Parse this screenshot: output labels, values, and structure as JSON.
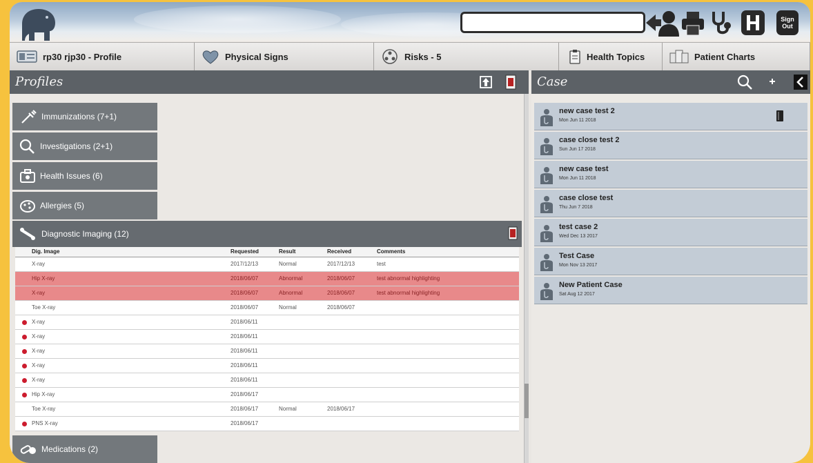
{
  "header": {
    "search_placeholder": "",
    "signout_line1": "Sign",
    "signout_line2": "Out"
  },
  "tabs": [
    {
      "label": "rp30 rjp30 - Profile"
    },
    {
      "label": "Physical Signs"
    },
    {
      "label": "Risks - 5"
    },
    {
      "label": "Health Topics"
    },
    {
      "label": "Patient Charts"
    }
  ],
  "profiles": {
    "title": "Profiles",
    "categories": [
      {
        "label": "Immunizations  (7+1)"
      },
      {
        "label": "Investigations  (2+1)"
      },
      {
        "label": "Health Issues  (6)"
      },
      {
        "label": "Allergies  (5)"
      }
    ],
    "diagnostic_imaging": {
      "label": "Diagnostic Imaging  (12)",
      "columns": [
        "Dig. Image",
        "Requested",
        "Result",
        "Received",
        "Comments"
      ],
      "rows": [
        {
          "image": "X-ray",
          "requested": "2017/12/13",
          "result": "Normal",
          "received": "2017/12/13",
          "comments": "test"
        },
        {
          "image": "Hip X-ray",
          "requested": "2018/06/07",
          "result": "Abnormal",
          "received": "2018/06/07",
          "comments": "test abnormal highlighting"
        },
        {
          "image": "X-ray",
          "requested": "2018/06/07",
          "result": "Abnormal",
          "received": "2018/06/07",
          "comments": "test abnormal highlighting"
        },
        {
          "image": "Toe X-ray",
          "requested": "2018/06/07",
          "result": "Normal",
          "received": "2018/06/07",
          "comments": ""
        },
        {
          "image": "X-ray",
          "requested": "2018/06/11",
          "result": "",
          "received": "",
          "comments": ""
        },
        {
          "image": "X-ray",
          "requested": "2018/06/11",
          "result": "",
          "received": "",
          "comments": ""
        },
        {
          "image": "X-ray",
          "requested": "2018/06/11",
          "result": "",
          "received": "",
          "comments": ""
        },
        {
          "image": "X-ray",
          "requested": "2018/06/11",
          "result": "",
          "received": "",
          "comments": ""
        },
        {
          "image": "X-ray",
          "requested": "2018/06/11",
          "result": "",
          "received": "",
          "comments": ""
        },
        {
          "image": "Hip X-ray",
          "requested": "2018/06/17",
          "result": "",
          "received": "",
          "comments": ""
        },
        {
          "image": "Toe X-ray",
          "requested": "2018/06/17",
          "result": "Normal",
          "received": "2018/06/17",
          "comments": ""
        },
        {
          "image": "PNS X-ray",
          "requested": "2018/06/17",
          "result": "",
          "received": "",
          "comments": ""
        }
      ]
    },
    "medications": {
      "label": "Medications  (2)"
    }
  },
  "case": {
    "title": "Case",
    "items": [
      {
        "title": "new case test 2",
        "date": "Mon Jun 11 2018"
      },
      {
        "title": "case close test 2",
        "date": "Sun Jun 17 2018"
      },
      {
        "title": "new case test",
        "date": "Mon Jun 11 2018"
      },
      {
        "title": "case close test",
        "date": "Thu Jun 7 2018"
      },
      {
        "title": "test case 2",
        "date": "Wed Dec 13 2017"
      },
      {
        "title": "Test Case",
        "date": "Mon Nov 13 2017"
      },
      {
        "title": "New Patient Case",
        "date": "Sat Aug 12 2017"
      }
    ]
  },
  "colors": {
    "frame": "#f6c23e",
    "panel_header": "#5c6166",
    "category": "#73787c",
    "case_item": "#c3ccd6",
    "abnormal_row": "#e8898a",
    "pending_dot": "#cc1c2e"
  }
}
